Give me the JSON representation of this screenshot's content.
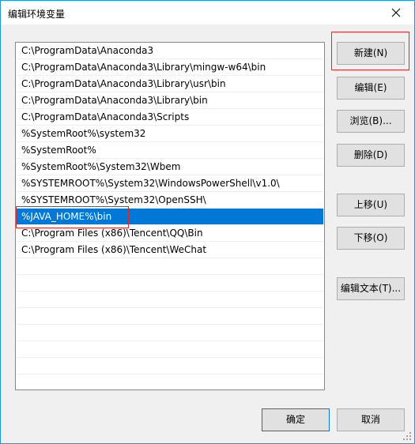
{
  "window": {
    "title": "编辑环境变量"
  },
  "path_list": {
    "items": [
      "C:\\ProgramData\\Anaconda3",
      "C:\\ProgramData\\Anaconda3\\Library\\mingw-w64\\bin",
      "C:\\ProgramData\\Anaconda3\\Library\\usr\\bin",
      "C:\\ProgramData\\Anaconda3\\Library\\bin",
      "C:\\ProgramData\\Anaconda3\\Scripts",
      "%SystemRoot%\\system32",
      "%SystemRoot%",
      "%SystemRoot%\\System32\\Wbem",
      "%SYSTEMROOT%\\System32\\WindowsPowerShell\\v1.0\\",
      "%SYSTEMROOT%\\System32\\OpenSSH\\",
      "%JAVA_HOME%\\bin",
      "C:\\Program Files (x86)\\Tencent\\QQ\\Bin",
      "C:\\Program Files (x86)\\Tencent\\WeChat"
    ],
    "selected_index": 10
  },
  "buttons": {
    "new": "新建(N)",
    "edit": "编辑(E)",
    "browse": "浏览(B)...",
    "delete": "删除(D)",
    "move_up": "上移(U)",
    "move_down": "下移(O)",
    "edit_text": "编辑文本(T)...",
    "ok": "确定",
    "cancel": "取消"
  },
  "colors": {
    "selection": "#0078d7",
    "annotation": "#e02a2a",
    "window_border": "#1a9bd8"
  },
  "icons": {
    "close": "close-icon",
    "resize": "resize-grip-icon"
  }
}
